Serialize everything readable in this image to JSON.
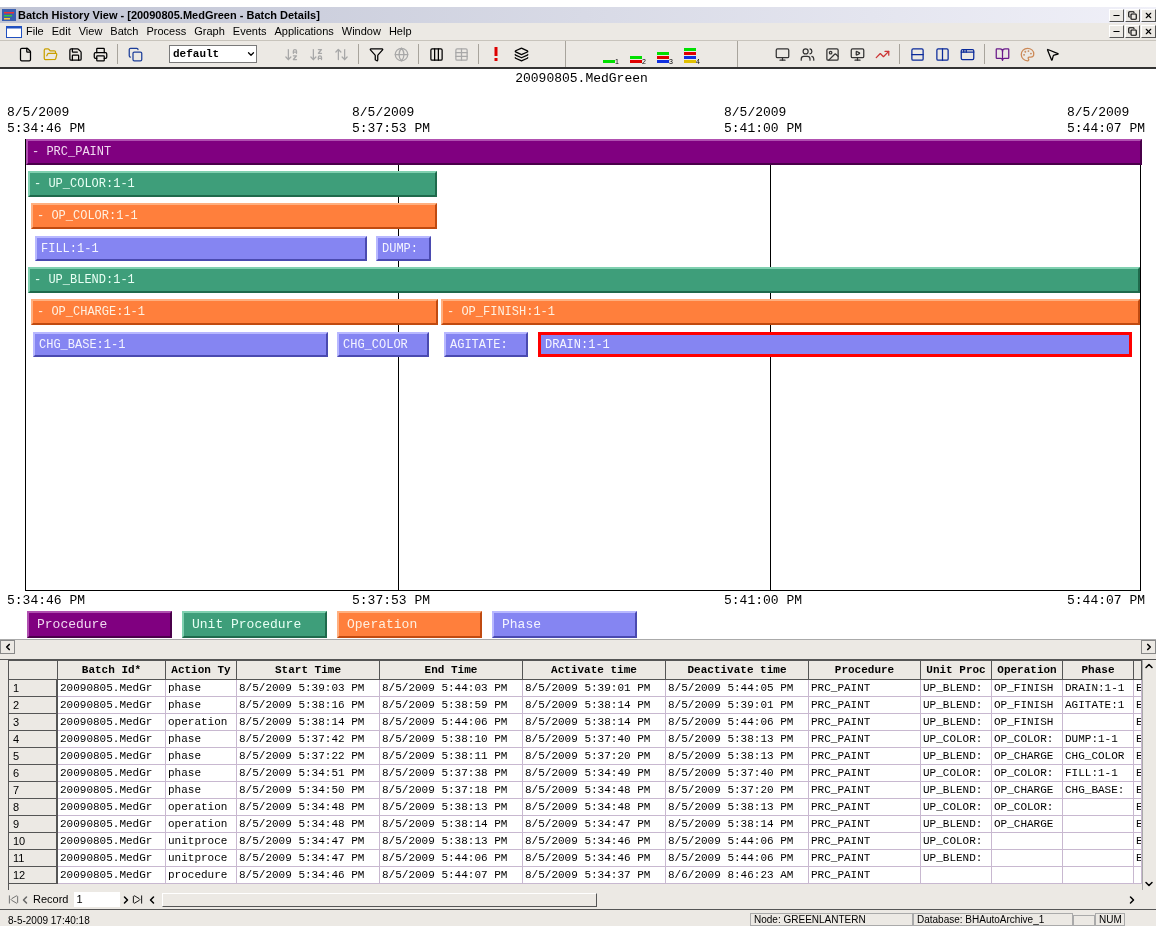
{
  "window": {
    "title": "Batch History View - [20090805.MedGreen - Batch Details]"
  },
  "menu": [
    "File",
    "Edit",
    "View",
    "Batch",
    "Process",
    "Graph",
    "Events",
    "Applications",
    "Window",
    "Help"
  ],
  "toolbar": {
    "view_combo": {
      "value": "default"
    },
    "buttons": [
      {
        "kind": "new",
        "disabled": false
      },
      {
        "kind": "open",
        "disabled": false
      },
      {
        "kind": "save",
        "disabled": false
      },
      {
        "kind": "print",
        "disabled": false
      },
      {
        "kind": "sep"
      },
      {
        "kind": "copy",
        "disabled": false
      },
      {
        "kind": "combo"
      },
      {
        "kind": "sort_az",
        "disabled": true
      },
      {
        "kind": "sort_za",
        "disabled": true
      },
      {
        "kind": "sort_custom",
        "disabled": true
      },
      {
        "kind": "sep"
      },
      {
        "kind": "filter",
        "disabled": false
      },
      {
        "kind": "globe",
        "disabled": true
      },
      {
        "kind": "sep"
      },
      {
        "kind": "columns",
        "disabled": false
      },
      {
        "kind": "grid",
        "disabled": true
      },
      {
        "kind": "sep"
      },
      {
        "kind": "alert",
        "disabled": false
      },
      {
        "kind": "layers",
        "disabled": false
      },
      {
        "kind": "gap"
      },
      {
        "kind": "level",
        "label": "1",
        "disabled": false
      },
      {
        "kind": "level",
        "label": "2",
        "disabled": false
      },
      {
        "kind": "level",
        "label": "3",
        "disabled": false
      },
      {
        "kind": "level",
        "label": "4",
        "disabled": false
      },
      {
        "kind": "gap"
      },
      {
        "kind": "monitor",
        "disabled": false
      },
      {
        "kind": "users",
        "disabled": false
      },
      {
        "kind": "image",
        "disabled": false
      },
      {
        "kind": "screen",
        "disabled": false
      },
      {
        "kind": "chart",
        "disabled": false
      },
      {
        "kind": "sep"
      },
      {
        "kind": "rows",
        "disabled": false
      },
      {
        "kind": "split",
        "disabled": false
      },
      {
        "kind": "window",
        "disabled": false
      },
      {
        "kind": "sep"
      },
      {
        "kind": "book",
        "disabled": false
      },
      {
        "kind": "palette",
        "disabled": false
      },
      {
        "kind": "help",
        "disabled": false
      }
    ]
  },
  "gantt": {
    "title": "20090805.MedGreen",
    "top_labels": [
      {
        "date": "8/5/2009",
        "time": "5:34:46 PM"
      },
      {
        "date": "8/5/2009",
        "time": "5:37:53 PM"
      },
      {
        "date": "8/5/2009",
        "time": "5:41:00 PM"
      },
      {
        "date": "8/5/2009",
        "time": "5:44:07 PM"
      }
    ],
    "bottom_labels": [
      "5:34:46 PM",
      "5:37:53 PM",
      "5:41:00 PM",
      "5:44:07 PM"
    ],
    "bars": [
      {
        "label": "- PRC_PAINT",
        "kind": "procedure",
        "selected": false
      },
      {
        "label": "- UP_COLOR:1-1",
        "kind": "unit_procedure",
        "selected": false
      },
      {
        "label": "- OP_COLOR:1-1",
        "kind": "operation",
        "selected": false
      },
      {
        "label": "FILL:1-1",
        "kind": "phase",
        "selected": false
      },
      {
        "label": "DUMP:",
        "kind": "phase",
        "selected": false
      },
      {
        "label": "- UP_BLEND:1-1",
        "kind": "unit_procedure",
        "selected": false
      },
      {
        "label": "- OP_CHARGE:1-1",
        "kind": "operation",
        "selected": false
      },
      {
        "label": "- OP_FINISH:1-1",
        "kind": "operation",
        "selected": false
      },
      {
        "label": "CHG_BASE:1-1",
        "kind": "phase",
        "selected": false
      },
      {
        "label": "CHG_COLOR",
        "kind": "phase",
        "selected": false
      },
      {
        "label": "AGITATE:",
        "kind": "phase",
        "selected": false
      },
      {
        "label": "DRAIN:1-1",
        "kind": "phase",
        "selected": true
      }
    ],
    "legend": [
      {
        "label": "Procedure",
        "kind": "procedure"
      },
      {
        "label": "Unit Procedure",
        "kind": "unit_procedure"
      },
      {
        "label": "Operation",
        "kind": "operation"
      },
      {
        "label": "Phase",
        "kind": "phase"
      }
    ]
  },
  "table": {
    "columns": [
      "Batch Id*",
      "Action Ty",
      "Start Time",
      "End Time",
      "Activate time",
      "Deactivate time",
      "Procedure",
      "Unit Proc",
      "Operation",
      "Phase"
    ],
    "rows": [
      {
        "number": "1",
        "cells": [
          "20090805.MedGr",
          "phase",
          "8/5/2009 5:39:03 PM",
          "8/5/2009 5:44:03 PM",
          "8/5/2009 5:39:01 PM",
          "8/5/2009 5:44:05 PM",
          "PRC_PAINT",
          "UP_BLEND:",
          "OP_FINISH",
          "DRAIN:1-1",
          "E"
        ]
      },
      {
        "number": "2",
        "cells": [
          "20090805.MedGr",
          "phase",
          "8/5/2009 5:38:16 PM",
          "8/5/2009 5:38:59 PM",
          "8/5/2009 5:38:14 PM",
          "8/5/2009 5:39:01 PM",
          "PRC_PAINT",
          "UP_BLEND:",
          "OP_FINISH",
          "AGITATE:1",
          "E"
        ]
      },
      {
        "number": "3",
        "cells": [
          "20090805.MedGr",
          "operation",
          "8/5/2009 5:38:14 PM",
          "8/5/2009 5:44:06 PM",
          "8/5/2009 5:38:14 PM",
          "8/5/2009 5:44:06 PM",
          "PRC_PAINT",
          "UP_BLEND:",
          "OP_FINISH",
          null,
          "E"
        ]
      },
      {
        "number": "4",
        "cells": [
          "20090805.MedGr",
          "phase",
          "8/5/2009 5:37:42 PM",
          "8/5/2009 5:38:10 PM",
          "8/5/2009 5:37:40 PM",
          "8/5/2009 5:38:13 PM",
          "PRC_PAINT",
          "UP_COLOR:",
          "OP_COLOR:",
          "DUMP:1-1",
          "E"
        ]
      },
      {
        "number": "5",
        "cells": [
          "20090805.MedGr",
          "phase",
          "8/5/2009 5:37:22 PM",
          "8/5/2009 5:38:11 PM",
          "8/5/2009 5:37:20 PM",
          "8/5/2009 5:38:13 PM",
          "PRC_PAINT",
          "UP_BLEND:",
          "OP_CHARGE",
          "CHG_COLOR",
          "E"
        ]
      },
      {
        "number": "6",
        "cells": [
          "20090805.MedGr",
          "phase",
          "8/5/2009 5:34:51 PM",
          "8/5/2009 5:37:38 PM",
          "8/5/2009 5:34:49 PM",
          "8/5/2009 5:37:40 PM",
          "PRC_PAINT",
          "UP_COLOR:",
          "OP_COLOR:",
          "FILL:1-1",
          "E"
        ]
      },
      {
        "number": "7",
        "cells": [
          "20090805.MedGr",
          "phase",
          "8/5/2009 5:34:50 PM",
          "8/5/2009 5:37:18 PM",
          "8/5/2009 5:34:48 PM",
          "8/5/2009 5:37:20 PM",
          "PRC_PAINT",
          "UP_BLEND:",
          "OP_CHARGE",
          "CHG_BASE:",
          "E"
        ]
      },
      {
        "number": "8",
        "cells": [
          "20090805.MedGr",
          "operation",
          "8/5/2009 5:34:48 PM",
          "8/5/2009 5:38:13 PM",
          "8/5/2009 5:34:48 PM",
          "8/5/2009 5:38:13 PM",
          "PRC_PAINT",
          "UP_COLOR:",
          "OP_COLOR:",
          null,
          "E"
        ]
      },
      {
        "number": "9",
        "cells": [
          "20090805.MedGr",
          "operation",
          "8/5/2009 5:34:48 PM",
          "8/5/2009 5:38:14 PM",
          "8/5/2009 5:34:47 PM",
          "8/5/2009 5:38:14 PM",
          "PRC_PAINT",
          "UP_BLEND:",
          "OP_CHARGE",
          null,
          "E"
        ]
      },
      {
        "number": "10",
        "cells": [
          "20090805.MedGr",
          "unitproce",
          "8/5/2009 5:34:47 PM",
          "8/5/2009 5:38:13 PM",
          "8/5/2009 5:34:46 PM",
          "8/5/2009 5:44:06 PM",
          "PRC_PAINT",
          "UP_COLOR:",
          null,
          null,
          "E"
        ]
      },
      {
        "number": "11",
        "cells": [
          "20090805.MedGr",
          "unitproce",
          "8/5/2009 5:34:47 PM",
          "8/5/2009 5:44:06 PM",
          "8/5/2009 5:34:46 PM",
          "8/5/2009 5:44:06 PM",
          "PRC_PAINT",
          "UP_BLEND:",
          null,
          null,
          "E"
        ]
      },
      {
        "number": "12",
        "cells": [
          "20090805.MedGr",
          "procedure",
          "8/5/2009 5:34:46 PM",
          "8/5/2009 5:44:07 PM",
          "8/5/2009 5:34:37 PM",
          "8/6/2009 8:46:23 AM",
          "PRC_PAINT",
          null,
          null,
          null,
          null
        ]
      }
    ]
  },
  "record_nav": {
    "label": "Record",
    "value": "1"
  },
  "status_bar": [
    "8-5-2009 17:40:18",
    "Node: GREENLANTERN",
    "Database: BHAutoArchive_1",
    "NUM"
  ]
}
